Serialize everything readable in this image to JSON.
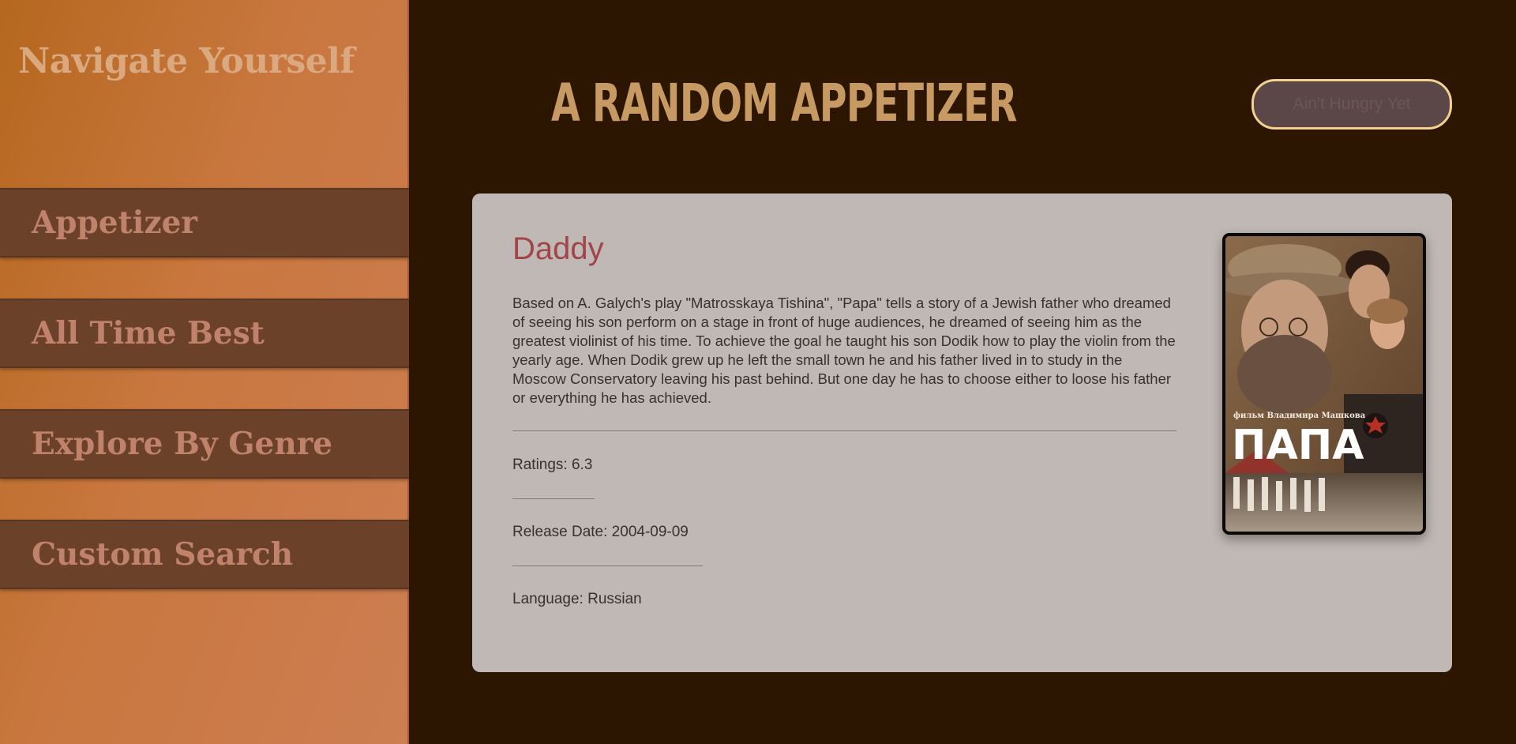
{
  "sidebar": {
    "title": "Navigate Yourself",
    "items": [
      {
        "label": "Appetizer"
      },
      {
        "label": "All Time Best"
      },
      {
        "label": "Explore By Genre"
      },
      {
        "label": "Custom Search"
      }
    ]
  },
  "main": {
    "title": "A RANDOM APPETIZER",
    "action_button": "Ain't Hungry Yet"
  },
  "movie": {
    "title": "Daddy",
    "description": "Based on A. Galych's play \"Matrosskaya Tishina\", \"Papa\" tells a story of a Jewish father who dreamed of seeing his son perform on a stage in front of huge audiences, he dreamed of seeing him as the greatest violinist of his time. To achieve the goal he taught his son Dodik how to play the violin from the yearly age. When Dodik grew up he left the small town he and his father lived in to study in the Moscow Conservatory leaving his past behind. But one day he has to choose either to loose his father or everything he has achieved.",
    "rating": "Ratings: 6.3",
    "release_date": "Release Date: 2004-09-09",
    "language": "Language: Russian",
    "poster": {
      "subtitle": "фильм Владимира Машкова",
      "title": "ПАПА"
    }
  },
  "colors": {
    "sidebar_bg": "#c9773f",
    "nav_item_bg": "#6b4129",
    "nav_text": "#c0826b",
    "main_bg": "#2c1601",
    "main_title": "#c79a64",
    "card_bg": "#c0b8b4",
    "movie_title": "#a2454a",
    "button_border": "#f3d18e"
  }
}
